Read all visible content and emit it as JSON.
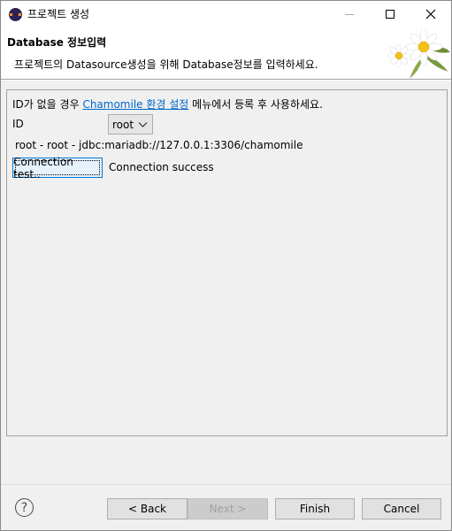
{
  "window": {
    "title": "프로젝트 생성"
  },
  "banner": {
    "title": "Database 정보입력",
    "description": "프로젝트의 Datasource생성을 위해 Database정보를 입력하세요."
  },
  "form": {
    "hint_prefix": "ID가 없을 경우 ",
    "hint_link": "Chamomile 환경 설정",
    "hint_suffix": " 메뉴에서 등록 후 사용하세요.",
    "id_label": "ID",
    "id_value": "root",
    "datasource_info": "root - root - jdbc:mariadb://127.0.0.1:3306/chamomile",
    "connection_test_label": "Connection test..",
    "connection_status": "Connection success"
  },
  "footer": {
    "back_label": "< Back",
    "next_label": "Next >",
    "finish_label": "Finish",
    "cancel_label": "Cancel",
    "next_enabled": false
  },
  "colors": {
    "link": "#0066cc",
    "focus_border": "#0078d7",
    "panel_bg": "#f0f0f0"
  },
  "icons": {
    "app": "eclipse-icon",
    "banner": "chamomile-flower-image",
    "help": "help-icon"
  }
}
